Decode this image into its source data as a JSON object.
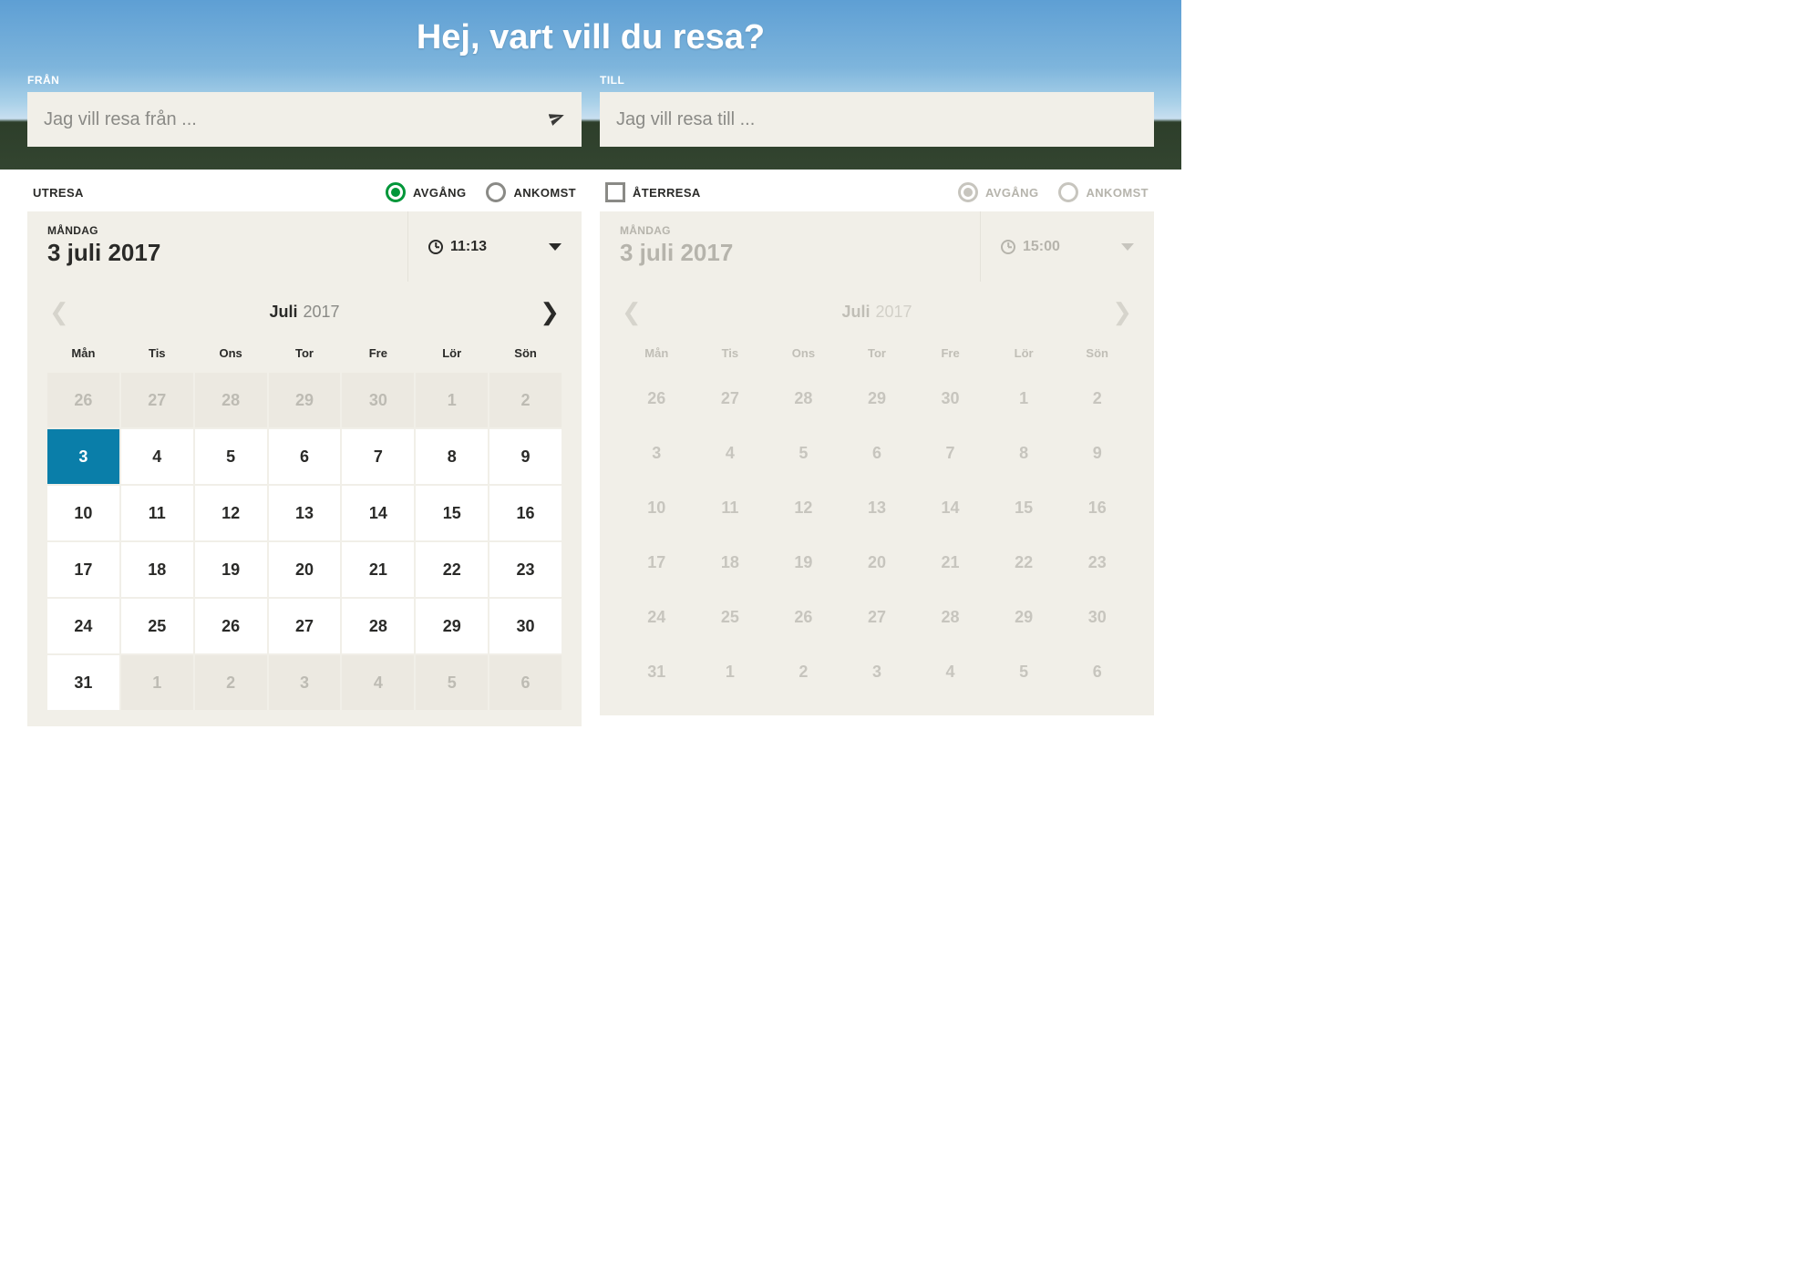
{
  "hero": {
    "title": "Hej, vart vill du resa?",
    "from_label": "FRÅN",
    "from_placeholder": "Jag vill resa från ...",
    "to_label": "TILL",
    "to_placeholder": "Jag vill resa till ..."
  },
  "departure": {
    "title": "UTRESA",
    "radio_depart": "AVGÅNG",
    "radio_arrive": "ANKOMST",
    "date_weekday": "MÅNDAG",
    "date_text": "3 juli 2017",
    "time": "11:13",
    "cal_month": "Juli",
    "cal_year": "2017"
  },
  "return": {
    "title": "ÅTERRESA",
    "radio_depart": "AVGÅNG",
    "radio_arrive": "ANKOMST",
    "date_weekday": "MÅNDAG",
    "date_text": "3 juli 2017",
    "time": "15:00",
    "cal_month": "Juli",
    "cal_year": "2017"
  },
  "dow": [
    "Mån",
    "Tis",
    "Ons",
    "Tor",
    "Fre",
    "Lör",
    "Sön"
  ],
  "days": [
    {
      "n": "26",
      "other": true
    },
    {
      "n": "27",
      "other": true
    },
    {
      "n": "28",
      "other": true
    },
    {
      "n": "29",
      "other": true
    },
    {
      "n": "30",
      "other": true
    },
    {
      "n": "1",
      "other": true
    },
    {
      "n": "2",
      "other": true
    },
    {
      "n": "3",
      "selected": true
    },
    {
      "n": "4"
    },
    {
      "n": "5"
    },
    {
      "n": "6"
    },
    {
      "n": "7"
    },
    {
      "n": "8"
    },
    {
      "n": "9"
    },
    {
      "n": "10"
    },
    {
      "n": "11"
    },
    {
      "n": "12"
    },
    {
      "n": "13"
    },
    {
      "n": "14"
    },
    {
      "n": "15"
    },
    {
      "n": "16"
    },
    {
      "n": "17"
    },
    {
      "n": "18"
    },
    {
      "n": "19"
    },
    {
      "n": "20"
    },
    {
      "n": "21"
    },
    {
      "n": "22"
    },
    {
      "n": "23"
    },
    {
      "n": "24"
    },
    {
      "n": "25"
    },
    {
      "n": "26"
    },
    {
      "n": "27"
    },
    {
      "n": "28"
    },
    {
      "n": "29"
    },
    {
      "n": "30"
    },
    {
      "n": "31"
    },
    {
      "n": "1",
      "other": true
    },
    {
      "n": "2",
      "other": true
    },
    {
      "n": "3",
      "other": true
    },
    {
      "n": "4",
      "other": true
    },
    {
      "n": "5",
      "other": true
    },
    {
      "n": "6",
      "other": true
    }
  ]
}
